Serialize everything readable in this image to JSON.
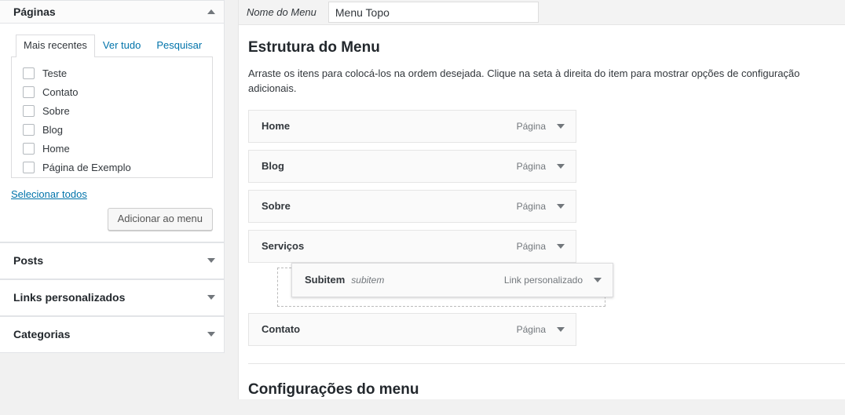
{
  "sidebar": {
    "pages_panel": {
      "title": "Páginas",
      "toggle_icon": "chevron-up-icon",
      "tabs": [
        {
          "label": "Mais recentes",
          "active": true
        },
        {
          "label": "Ver tudo",
          "active": false
        },
        {
          "label": "Pesquisar",
          "active": false
        }
      ],
      "items": [
        {
          "label": "Teste",
          "checked": false
        },
        {
          "label": "Contato",
          "checked": false
        },
        {
          "label": "Sobre",
          "checked": false
        },
        {
          "label": "Blog",
          "checked": false
        },
        {
          "label": "Home",
          "checked": false
        },
        {
          "label": "Página de Exemplo",
          "checked": false
        }
      ],
      "select_all_label": "Selecionar todos",
      "add_button_label": "Adicionar ao menu"
    },
    "collapsed_panels": [
      {
        "title": "Posts",
        "toggle_icon": "chevron-down-icon"
      },
      {
        "title": "Links personalizados",
        "toggle_icon": "chevron-down-icon"
      },
      {
        "title": "Categorias",
        "toggle_icon": "chevron-down-icon"
      }
    ]
  },
  "menu_name_bar": {
    "label": "Nome do Menu",
    "value": "Menu Topo",
    "placeholder": "Digite o nome do menu"
  },
  "structure": {
    "title": "Estrutura do Menu",
    "description": "Arraste os itens para colocá-los na ordem desejada. Clique na seta à direita do item para mostrar opções de configuração adicionais.",
    "items": [
      {
        "title": "Home",
        "subtitle": "",
        "type": "Página",
        "toggle_icon": "chevron-down-icon"
      },
      {
        "title": "Blog",
        "subtitle": "",
        "type": "Página",
        "toggle_icon": "chevron-down-icon"
      },
      {
        "title": "Sobre",
        "subtitle": "",
        "type": "Página",
        "toggle_icon": "chevron-down-icon"
      },
      {
        "title": "Serviços",
        "subtitle": "",
        "type": "Página",
        "toggle_icon": "chevron-down-icon"
      },
      {
        "title": "Contato",
        "subtitle": "",
        "type": "Página",
        "toggle_icon": "chevron-down-icon"
      }
    ],
    "dragged_item": {
      "title": "Subitem",
      "subtitle": "subitem",
      "type": "Link personalizado",
      "toggle_icon": "chevron-down-icon"
    }
  },
  "settings": {
    "title": "Configurações do menu"
  },
  "colors": {
    "link": "#0073aa",
    "text": "#32373c",
    "muted": "#72777c",
    "border": "#e5e5e5",
    "panel_bg": "#fafafa",
    "page_bg": "#f1f1f1"
  }
}
